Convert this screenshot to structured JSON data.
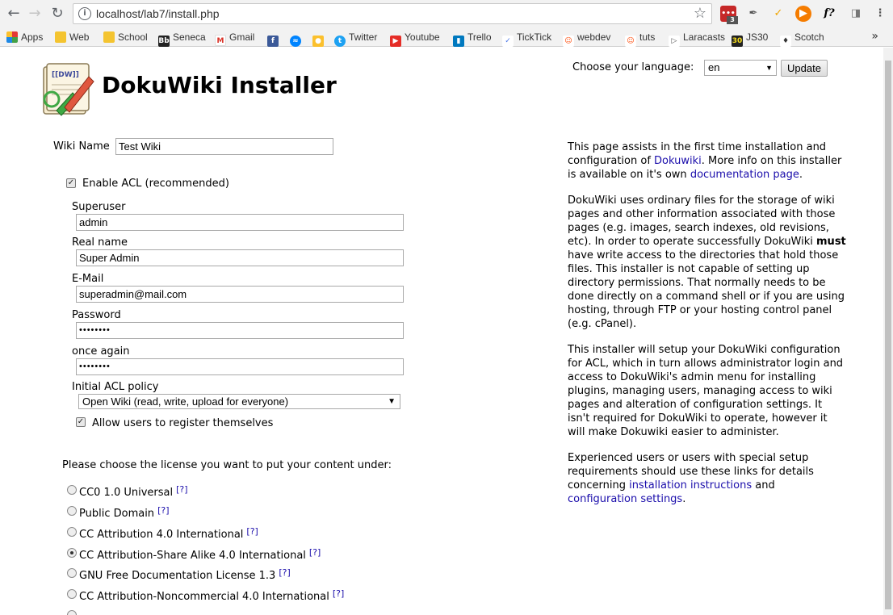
{
  "browser": {
    "url": "localhost/lab7/install.php",
    "extension_badge": "3",
    "bookmarks": [
      {
        "label": "Apps"
      },
      {
        "label": "Web"
      },
      {
        "label": "School"
      },
      {
        "label": "Seneca"
      },
      {
        "label": "Gmail"
      },
      {
        "label": ""
      },
      {
        "label": ""
      },
      {
        "label": ""
      },
      {
        "label": "Twitter"
      },
      {
        "label": "Youtube"
      },
      {
        "label": "Trello"
      },
      {
        "label": "TickTick"
      },
      {
        "label": "webdev"
      },
      {
        "label": "tuts"
      },
      {
        "label": "Laracasts"
      },
      {
        "label": "JS30"
      },
      {
        "label": "Scotch"
      }
    ]
  },
  "header": {
    "title": "DokuWiki Installer",
    "logo_text": "[[DW]]",
    "language_label": "Choose your language:",
    "language_value": "en",
    "update_label": "Update"
  },
  "form": {
    "wiki_name_label": "Wiki Name",
    "wiki_name_value": "Test Wiki",
    "enable_acl_label": "Enable ACL (recommended)",
    "superuser_label": "Superuser",
    "superuser_value": "admin",
    "realname_label": "Real name",
    "realname_value": "Super Admin",
    "email_label": "E-Mail",
    "email_value": "superadmin@mail.com",
    "password_label": "Password",
    "password_value": "••••••••",
    "again_label": "once again",
    "again_value": "••••••••",
    "acl_policy_label": "Initial ACL policy",
    "acl_policy_value": "Open Wiki (read, write, upload for everyone)",
    "allow_register_label": "Allow users to register themselves",
    "license_prompt": "Please choose the license you want to put your content under:",
    "help_mark": "[?]",
    "licenses": [
      {
        "label": "CC0 1.0 Universal"
      },
      {
        "label": "Public Domain"
      },
      {
        "label": "CC Attribution 4.0 International"
      },
      {
        "label": "CC Attribution-Share Alike 4.0 International"
      },
      {
        "label": "GNU Free Documentation License 1.3"
      },
      {
        "label": "CC Attribution-Noncommercial 4.0 International"
      }
    ]
  },
  "info": {
    "p1_a": "This page assists in the first time installation and configuration of ",
    "p1_link1": "Dokuwiki",
    "p1_b": ". More info on this installer is available on it's own ",
    "p1_link2": "documentation page",
    "p1_c": ".",
    "p2_a": "DokuWiki uses ordinary files for the storage of wiki pages and other information associated with those pages (e.g. images, search indexes, old revisions, etc). In order to operate successfully DokuWiki ",
    "p2_bold": "must",
    "p2_b": " have write access to the directories that hold those files. This installer is not capable of setting up directory permissions. That normally needs to be done directly on a command shell or if you are using hosting, through FTP or your hosting control panel (e.g. cPanel).",
    "p3": "This installer will setup your DokuWiki configuration for ACL, which in turn allows administrator login and access to DokuWiki's admin menu for installing plugins, managing users, managing access to wiki pages and alteration of configuration settings. It isn't required for DokuWiki to operate, however it will make Dokuwiki easier to administer.",
    "p4_a": "Experienced users or users with special setup requirements should use these links for details concerning ",
    "p4_link1": "installation instructions",
    "p4_b": " and ",
    "p4_link2": "configuration settings",
    "p4_c": "."
  }
}
